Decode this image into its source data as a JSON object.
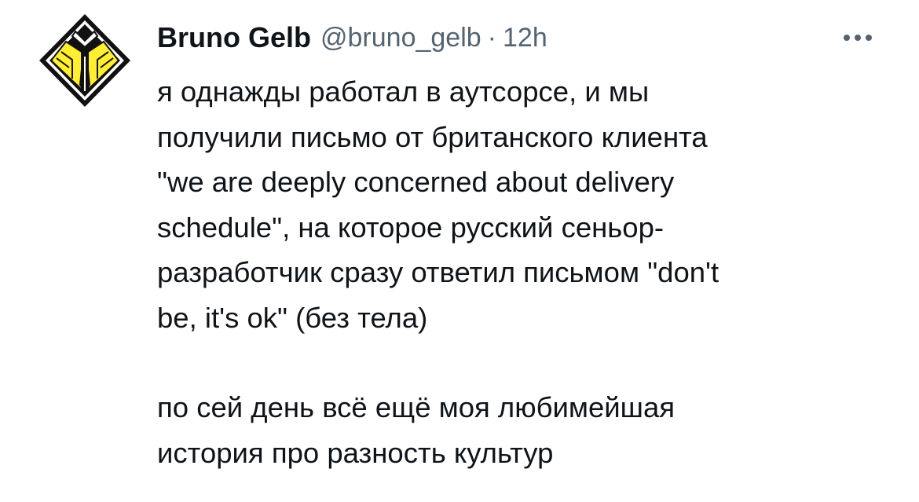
{
  "tweet": {
    "author": {
      "name": "Bruno Gelb",
      "handle": "@bruno_gelb",
      "avatar_icon": "yellow-diamond-tie-logo-icon"
    },
    "separator": "·",
    "time": "12h",
    "more_icon": "more-dots-icon",
    "paragraphs": [
      {
        "lines": [
          "я однажды работал в аутсорсе, и мы",
          "получили письмо от британского клиента",
          "\"we are deeply concerned about delivery",
          "schedule\", на которое русский сеньор-",
          "разработчик сразу ответил письмом \"don't",
          "be, it's ok\" (без тела)"
        ]
      },
      {
        "lines": [
          "по сей день всё ещё моя любимейшая",
          "история про разность культур"
        ]
      }
    ]
  },
  "colors": {
    "text": "#0f1419",
    "secondary": "#536471",
    "avatar_yellow": "#ffef2e",
    "avatar_black": "#111111"
  }
}
